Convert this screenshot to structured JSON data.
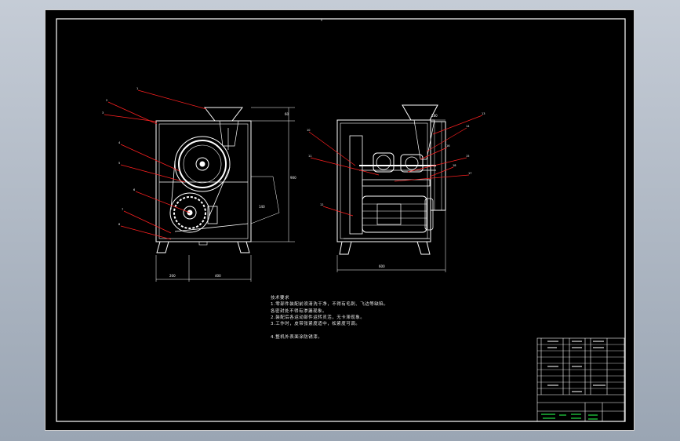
{
  "drawing": {
    "notes": {
      "title": "技术要求",
      "lines": [
        "1.零部件装配前须清洗干净，不得有毛刺、飞边等缺陷。",
        "各密封处不得有渗漏现象。",
        "2.装配后各运动部件运转灵活，无卡滞现象。",
        "3.工作时，皮带张紧度适中，松紧度可调。",
        "4.整机外表面涂防锈漆。"
      ]
    },
    "balloons_left": [
      "1",
      "2",
      "3",
      "4",
      "5",
      "6",
      "7",
      "8",
      "9"
    ],
    "balloons_right": [
      "10",
      "11",
      "12",
      "13",
      "14",
      "15",
      "16",
      "17",
      "18",
      "19"
    ],
    "dimensions": {
      "left_bottom_a": "200",
      "left_bottom_b": "400",
      "left_right_height": "900",
      "left_side_small": "60",
      "left_angle": "140",
      "right_bottom": "600",
      "right_top": "180"
    },
    "title_block": {
      "school": "",
      "drawing_name": "",
      "scale": "1:5"
    }
  },
  "colors": {
    "background": "#000000",
    "outline": "#ffffff",
    "leader": "#ff2020",
    "titleblock_green": "#22dd44",
    "viewport_frame": "#a8b2be"
  }
}
